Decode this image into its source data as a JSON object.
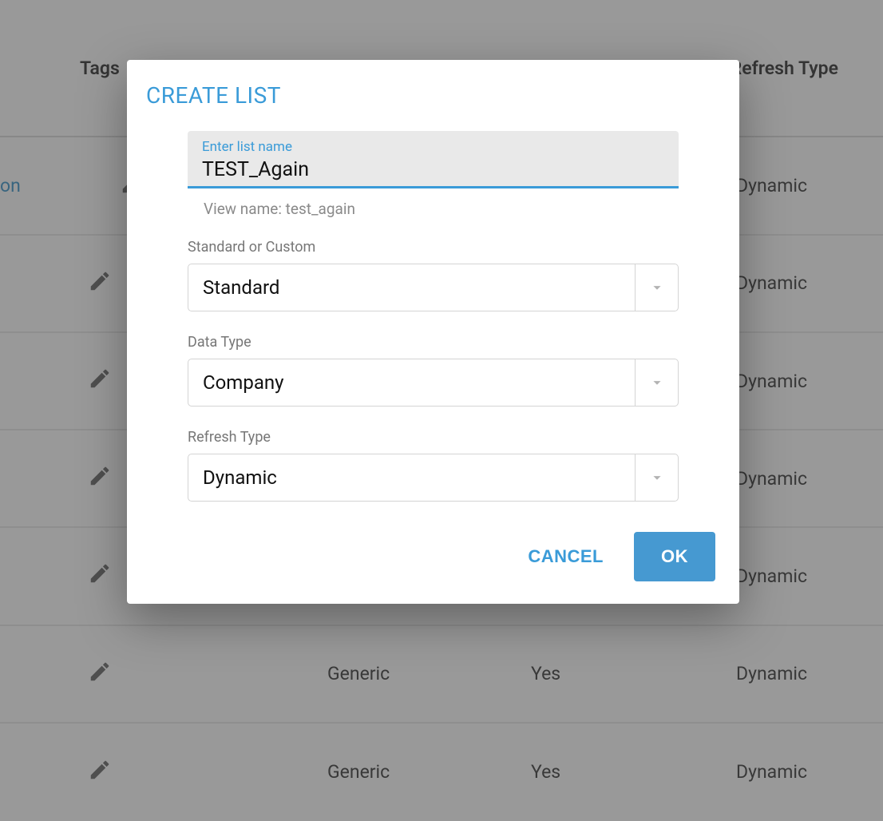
{
  "background": {
    "headers": {
      "tags": "Tags",
      "refresh_type": "Refresh Type"
    },
    "rows": [
      {
        "link_fragment": "on",
        "type": "",
        "yes": "",
        "refresh": "Dynamic"
      },
      {
        "type": "",
        "yes": "",
        "refresh": "Dynamic"
      },
      {
        "type": "",
        "yes": "",
        "refresh": "Dynamic"
      },
      {
        "type": "",
        "yes": "",
        "refresh": "Dynamic"
      },
      {
        "type": "",
        "yes": "",
        "refresh": "Dynamic"
      },
      {
        "type": "Generic",
        "yes": "Yes",
        "refresh": "Dynamic"
      },
      {
        "type": "Generic",
        "yes": "Yes",
        "refresh": "Dynamic"
      }
    ]
  },
  "modal": {
    "title": "CREATE LIST",
    "name_input": {
      "label": "Enter list name",
      "value": "TEST_Again"
    },
    "view_name": "View name: test_again",
    "fields": {
      "standard_custom": {
        "label": "Standard or Custom",
        "value": "Standard"
      },
      "data_type": {
        "label": "Data Type",
        "value": "Company"
      },
      "refresh_type": {
        "label": "Refresh Type",
        "value": "Dynamic"
      }
    },
    "buttons": {
      "cancel": "CANCEL",
      "ok": "OK"
    }
  }
}
